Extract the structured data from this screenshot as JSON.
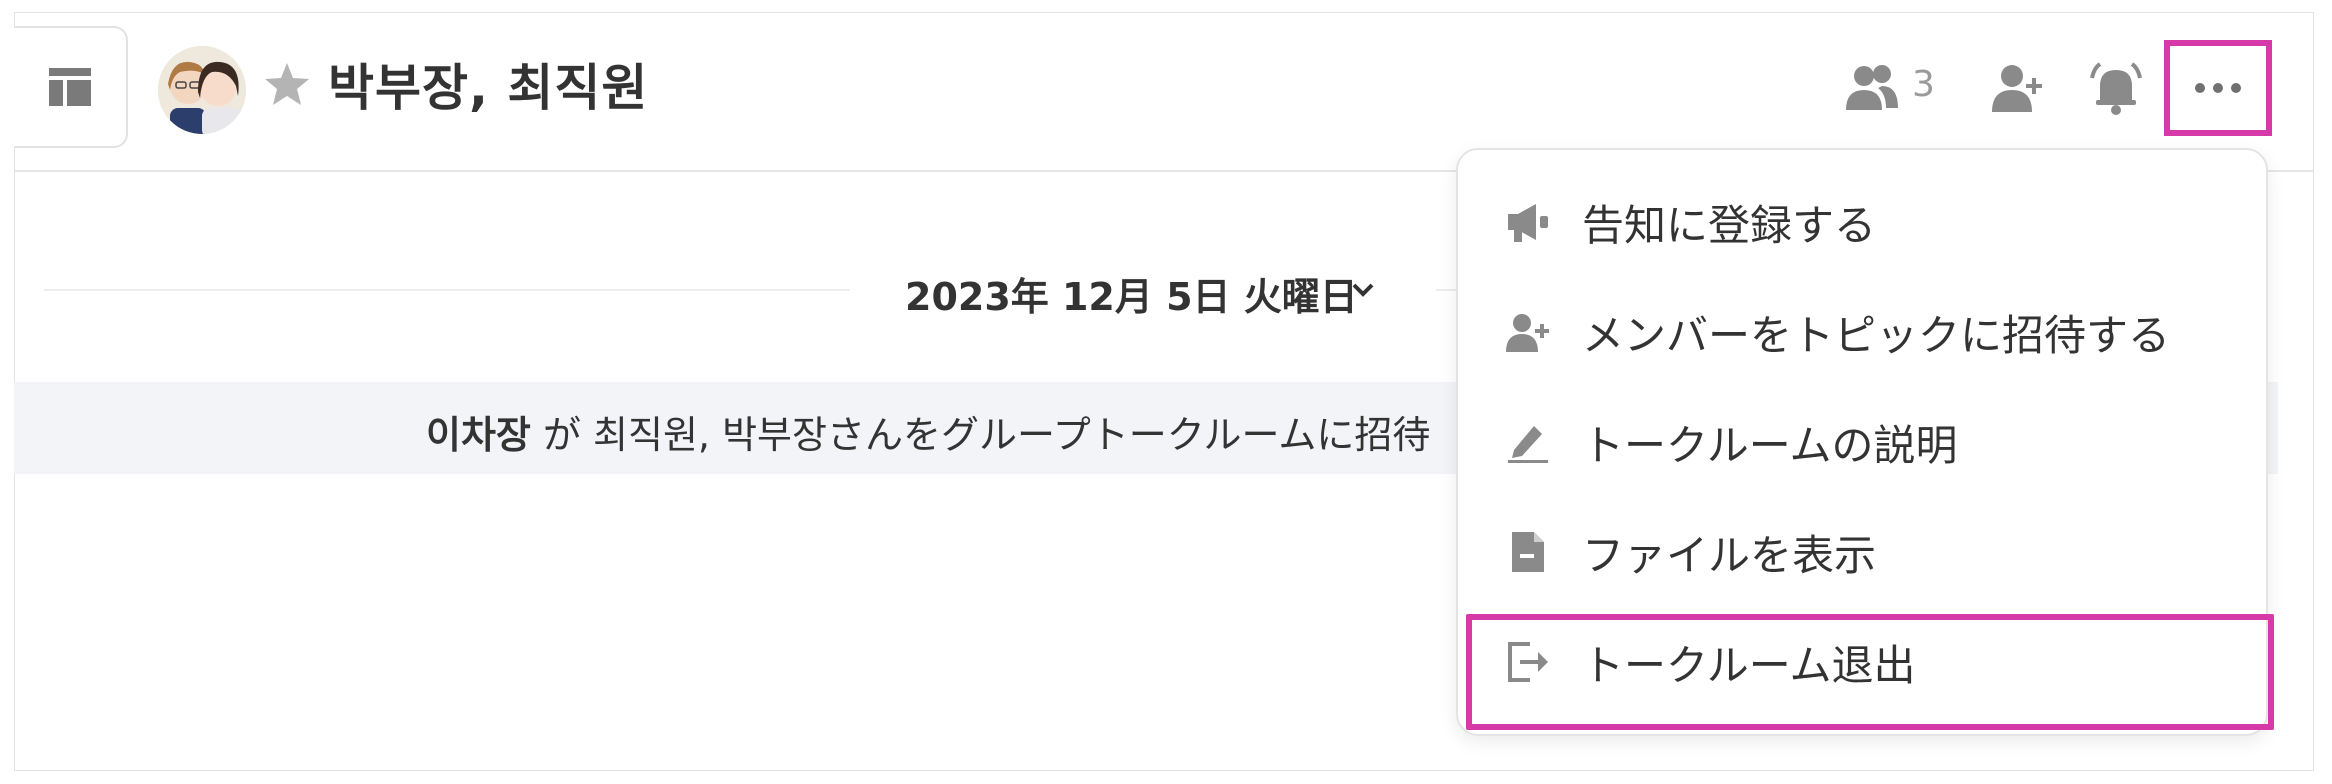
{
  "header": {
    "title": "박부장, 최직원",
    "member_count": "3"
  },
  "date_separator": {
    "label": "2023年 12月 5日 火曜日"
  },
  "system_message": {
    "actor": "이차장",
    "rest": " が 최직원, 박부장さんをグループトークルームに招待"
  },
  "menu": {
    "items": [
      {
        "label": "告知に登録する",
        "icon": "megaphone-icon"
      },
      {
        "label": "メンバーをトピックに招待する",
        "icon": "add-user-icon"
      },
      {
        "label": "トークルームの説明",
        "icon": "pencil-icon"
      },
      {
        "label": "ファイルを表示",
        "icon": "file-icon"
      },
      {
        "label": "トークルーム退出",
        "icon": "exit-icon"
      }
    ]
  },
  "colors": {
    "highlight": "#d63aa8",
    "icon_gray": "#8a8a8a",
    "banner_bg": "#f3f4f8"
  }
}
